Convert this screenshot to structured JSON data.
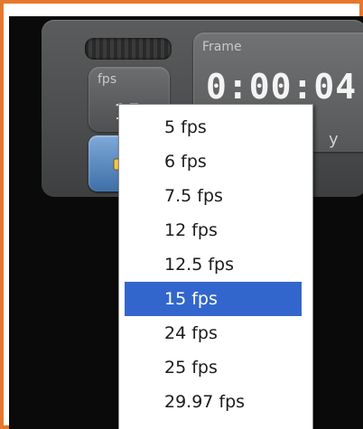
{
  "panel": {
    "fps": {
      "label": "fps",
      "value": "15"
    },
    "frame": {
      "label": "Frame",
      "timecode": "0:00:04",
      "partial_text": "y"
    }
  },
  "dropdown": {
    "options": [
      "5 fps",
      "6 fps",
      "7.5 fps",
      "12 fps",
      "12.5 fps",
      "15 fps",
      "24 fps",
      "25 fps",
      "29.97 fps"
    ],
    "selected": "15 fps"
  },
  "colors": {
    "frame_border": "#e8772e",
    "selection": "#3366cc",
    "accent_button": "#4f86c2"
  },
  "icons": [
    "printer-icon"
  ]
}
